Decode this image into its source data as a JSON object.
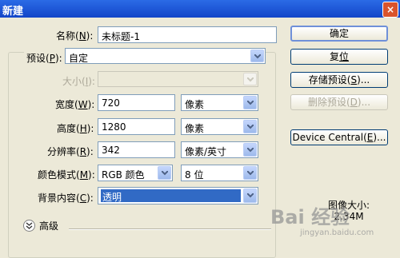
{
  "window": {
    "title": "新建",
    "close_label": "×"
  },
  "form": {
    "name": {
      "label": "名称(",
      "key": "N",
      "label_end": "):",
      "value": "未标题-1"
    },
    "preset": {
      "label": "预设(",
      "key": "P",
      "label_end": "):",
      "value": "自定"
    },
    "size": {
      "label": "大小(",
      "key": "I",
      "label_end": "):",
      "value": ""
    },
    "width": {
      "label": "宽度(",
      "key": "W",
      "label_end": "):",
      "value": "720",
      "unit": "像素"
    },
    "height": {
      "label": "高度(",
      "key": "H",
      "label_end": "):",
      "value": "1280",
      "unit": "像素"
    },
    "resolution": {
      "label": "分辨率(",
      "key": "R",
      "label_end": "):",
      "value": "342",
      "unit": "像素/英寸"
    },
    "color_mode": {
      "label": "颜色模式(",
      "key": "M",
      "label_end": "):",
      "value": "RGB 颜色",
      "depth": "8 位"
    },
    "background": {
      "label": "背景内容(",
      "key": "C",
      "label_end": "):",
      "value": "透明"
    },
    "advanced": {
      "label": "高级"
    }
  },
  "buttons": {
    "ok": "确定",
    "reset": {
      "text": "复",
      "key": "位"
    },
    "save_preset": {
      "text": "存储预设(",
      "key": "S",
      "end": ")..."
    },
    "delete_preset": {
      "text": "删除预设(",
      "key": "D",
      "end": ")..."
    },
    "device_central": {
      "text": "Device Central(",
      "key": "E",
      "end": ")..."
    }
  },
  "image_size": {
    "label": "图像大小:",
    "value": "2.34M"
  },
  "watermark": {
    "logo": "Bai 经验",
    "url": "jingyan.baidu.com"
  }
}
